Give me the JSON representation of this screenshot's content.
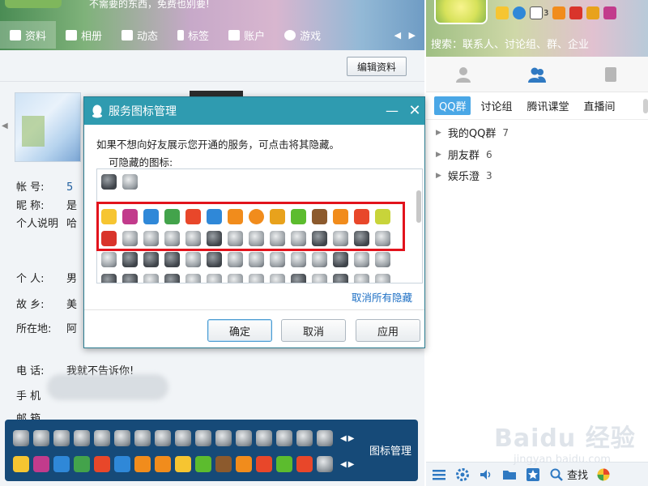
{
  "left_window": {
    "banner_tip": "不需要的东西，免费也别要!",
    "tabs": [
      {
        "label": "资料",
        "icon": "id-card-icon"
      },
      {
        "label": "相册",
        "icon": "photo-album-icon"
      },
      {
        "label": "动态",
        "icon": "feed-list-icon"
      },
      {
        "label": "标签",
        "icon": "bookmark-icon"
      },
      {
        "label": "账户",
        "icon": "briefcase-icon"
      },
      {
        "label": "游戏",
        "icon": "game-icon"
      }
    ],
    "edit_profile_label": "编辑资料",
    "fields": [
      {
        "label": "帐    号:",
        "value": "5"
      },
      {
        "label": "昵    称:",
        "value": "是"
      },
      {
        "label": "个人说明",
        "value": "哈"
      },
      {
        "label": "个    人:",
        "value": "男"
      },
      {
        "label": "故    乡:",
        "value": "美"
      },
      {
        "label": "所在地:",
        "value": "阿"
      },
      {
        "label": "电    话:",
        "value": "我就不告诉你!"
      },
      {
        "label": "手    机",
        "value": ""
      },
      {
        "label": "邮    箱",
        "value": ""
      }
    ],
    "icon_manage_label": "图标管理"
  },
  "dialog": {
    "title": "服务图标管理",
    "description": "如果不想向好友展示您开通的服务，可点击将其隐藏。",
    "hidden_icons_label": "可隐藏的图标:",
    "unhide_all_link": "取消所有隐藏",
    "ok_label": "确定",
    "cancel_label": "取消",
    "apply_label": "应用"
  },
  "right_panel": {
    "search_placeholder": "搜索：联系人、讨论组、群、企业",
    "mail_count": "3",
    "subtabs": [
      "QQ群",
      "讨论组",
      "腾讯课堂",
      "直播间"
    ],
    "groups": [
      {
        "name": "我的QQ群",
        "count": "7"
      },
      {
        "name": "朋友群",
        "count": "6"
      },
      {
        "name": "娱乐澄",
        "count": "3"
      }
    ],
    "find_label": "查找"
  },
  "watermark": {
    "brand": "Bai",
    "paw": "du",
    "jingyan": "经验",
    "url": "jingyan.baidu.com"
  },
  "colors": {
    "dialog_title_bg": "#2f9bb0",
    "highlight_border": "#e2131c",
    "link": "#1d6fc4",
    "icon_bar_bg": "#164a78",
    "active_subtab": "#4aa7e6"
  }
}
